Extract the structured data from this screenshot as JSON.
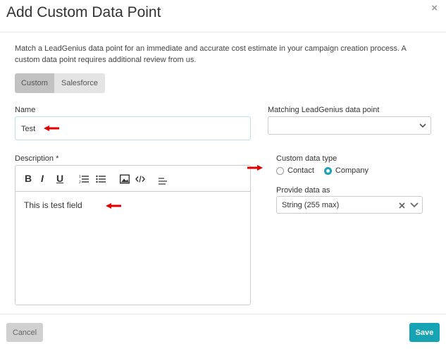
{
  "dialog": {
    "title": "Add Custom Data Point",
    "close_label": "×",
    "intro": "Match a LeadGenius data point for an immediate and accurate cost estimate in your campaign creation process. A custom data point requires additional review from us."
  },
  "type_toggle": {
    "options": [
      {
        "label": "Custom",
        "active": true
      },
      {
        "label": "Salesforce",
        "active": false
      }
    ]
  },
  "name_field": {
    "label": "Name",
    "value": "Test"
  },
  "matching_field": {
    "label": "Matching LeadGenius data point",
    "value": ""
  },
  "description_field": {
    "label": "Description *",
    "toolbar": {
      "bold": "B",
      "italic": "I",
      "underline": "U",
      "icons": [
        "ordered-list-icon",
        "unordered-list-icon",
        "image-icon",
        "code-icon",
        "align-icon"
      ]
    },
    "content": "This is test field"
  },
  "custom_data_type": {
    "label": "Custom data type",
    "options": [
      {
        "label": "Contact",
        "checked": false
      },
      {
        "label": "Company",
        "checked": true
      }
    ]
  },
  "provide_data_as": {
    "label": "Provide data as",
    "value": "String (255 max)"
  },
  "footer": {
    "cancel_label": "Cancel",
    "save_label": "Save"
  },
  "colors": {
    "accent": "#16a3b3",
    "annotation_arrow": "#e00000"
  }
}
